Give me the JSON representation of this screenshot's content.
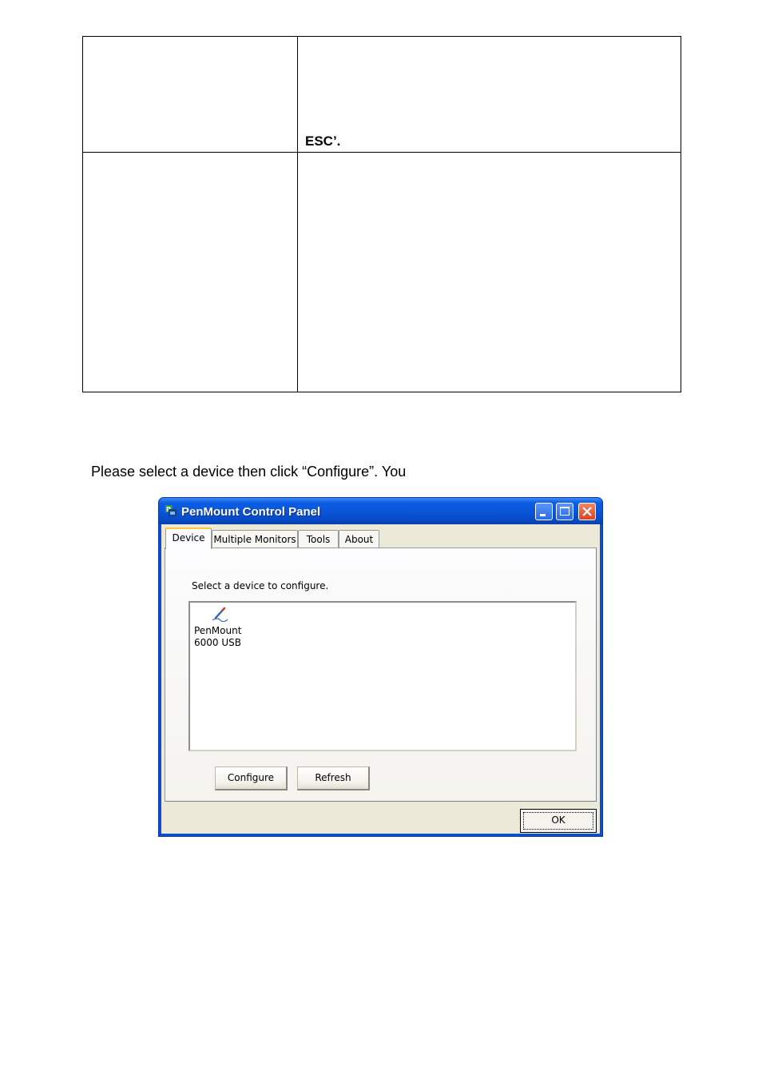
{
  "document": {
    "table": {
      "row1_right_text": "ESC’.",
      "row2_left_text": "",
      "row2_right_text": ""
    },
    "instruction": "Please select a device then click “Configure”. You"
  },
  "window": {
    "title": "PenMount Control Panel",
    "icons": {
      "app": "penmount-app-icon",
      "minimize": "minimize-icon",
      "maximize": "maximize-icon",
      "close": "close-icon",
      "device": "pen-device-icon"
    },
    "tabs": [
      {
        "label": "Device",
        "active": true
      },
      {
        "label": "Multiple Monitors",
        "active": false
      },
      {
        "label": "Tools",
        "active": false
      },
      {
        "label": "About",
        "active": false
      }
    ],
    "device_tab": {
      "prompt": "Select a device to configure.",
      "devices": [
        {
          "line1": "PenMount",
          "line2": "6000 USB"
        }
      ],
      "configure_label": "Configure",
      "refresh_label": "Refresh"
    },
    "ok_label": "OK",
    "colors": {
      "titlebar": "#0a54d6",
      "face": "#ece9d8",
      "active_tab_accent": "#ffc83c",
      "close_button": "#d9441f"
    }
  }
}
